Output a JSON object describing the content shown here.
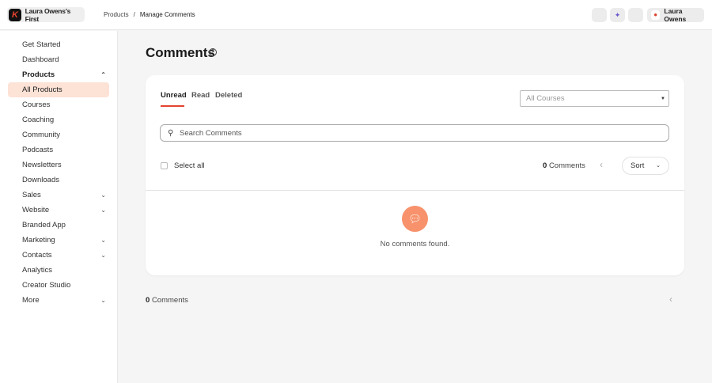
{
  "header": {
    "brand": "Laura Owens's First",
    "logo_letter": "K",
    "breadcrumb": [
      "Products",
      "/",
      "Manage Comments"
    ],
    "user": "Laura Owens"
  },
  "sidebar": {
    "items": [
      {
        "label": "Get Started"
      },
      {
        "label": "Dashboard"
      },
      {
        "label": "Products",
        "chev": "⌃"
      },
      {
        "label": "All Products"
      },
      {
        "label": "Courses"
      },
      {
        "label": "Coaching"
      },
      {
        "label": "Community"
      },
      {
        "label": "Podcasts"
      },
      {
        "label": "Newsletters"
      },
      {
        "label": "Downloads"
      },
      {
        "label": "Sales",
        "chev": "⌄"
      },
      {
        "label": "Website",
        "chev": "⌄"
      },
      {
        "label": "Branded App"
      },
      {
        "label": "Marketing",
        "chev": "⌄"
      },
      {
        "label": "Contacts",
        "chev": "⌄"
      },
      {
        "label": "Analytics"
      },
      {
        "label": "Creator Studio"
      },
      {
        "label": "More",
        "chev": "⌄"
      }
    ]
  },
  "page": {
    "title": "Comments",
    "tabs": [
      "Unread",
      "Read",
      "Deleted"
    ],
    "course_filter": "All Courses",
    "search_placeholder": "Search Comments",
    "select_all": "Select all",
    "count": "0",
    "count_label": "Comments",
    "sort": "Sort",
    "empty": "No comments found.",
    "bottom_count": "0",
    "bottom_label": "Comments"
  },
  "colors": {
    "accent": "#e5432f",
    "empty_icon": "#f7926c",
    "active_bg": "#fde2d6"
  }
}
